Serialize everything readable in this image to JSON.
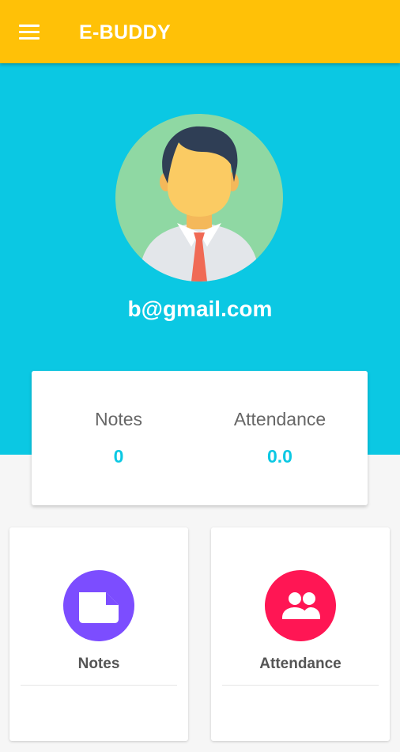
{
  "appbar": {
    "title": "E-BUDDY",
    "menu_icon": "hamburger-menu-icon",
    "color": "#FFC107"
  },
  "profile": {
    "email": "b@gmail.com",
    "avatar_icon": "user-avatar-icon",
    "hero_color": "#0BC8E3"
  },
  "stats": {
    "notes": {
      "label": "Notes",
      "value": "0"
    },
    "attendance": {
      "label": "Attendance",
      "value": "0.0"
    }
  },
  "tiles": [
    {
      "label": "Notes",
      "icon": "note-icon",
      "color": "#7C4DFF"
    },
    {
      "label": "Attendance",
      "icon": "people-icon",
      "color": "#FF1654"
    }
  ]
}
